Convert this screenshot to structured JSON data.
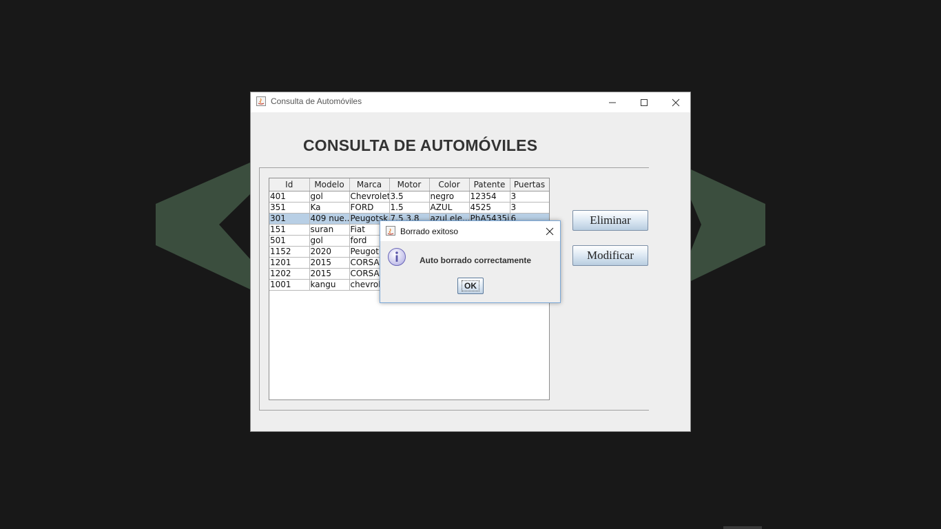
{
  "window": {
    "title": "Consulta de Automóviles",
    "heading": "CONSULTA DE AUTOMÓVILES"
  },
  "table": {
    "columns": [
      "Id",
      "Modelo",
      "Marca",
      "Motor",
      "Color",
      "Patente",
      "Puertas"
    ],
    "rows": [
      [
        "401",
        "gol",
        "Chevrolet",
        "3.5",
        "negro",
        "12354",
        "3"
      ],
      [
        "351",
        "Ka",
        "FORD",
        "1.5",
        "AZUL",
        "4525",
        "3"
      ],
      [
        "301",
        "409 nue...",
        "Peugotsk",
        "7.5 3.8",
        "azul ele...",
        "PhA5435i",
        "6"
      ],
      [
        "151",
        "suran",
        "Fiat",
        "",
        "",
        "",
        ""
      ],
      [
        "501",
        "gol",
        "ford",
        "",
        "",
        "",
        ""
      ],
      [
        "1152",
        "2020",
        "Peugot",
        "",
        "",
        "",
        ""
      ],
      [
        "1201",
        "2015",
        "CORSA",
        "",
        "",
        "",
        ""
      ],
      [
        "1202",
        "2015",
        "CORSA",
        "",
        "",
        "",
        ""
      ],
      [
        "1001",
        "kangu",
        "chevrole",
        "",
        "",
        "",
        ""
      ]
    ],
    "selected_row": 2
  },
  "buttons": {
    "eliminar": "Eliminar",
    "modificar": "Modificar"
  },
  "dialog": {
    "title": "Borrado exitoso",
    "message": "Auto borrado correctamente",
    "ok_label": "OK"
  },
  "colors": {
    "desktop_bg": "#181818",
    "chevron": "#3b4e3e",
    "selection": "#b8cfe5",
    "dialog_border": "#7aa7d6"
  }
}
